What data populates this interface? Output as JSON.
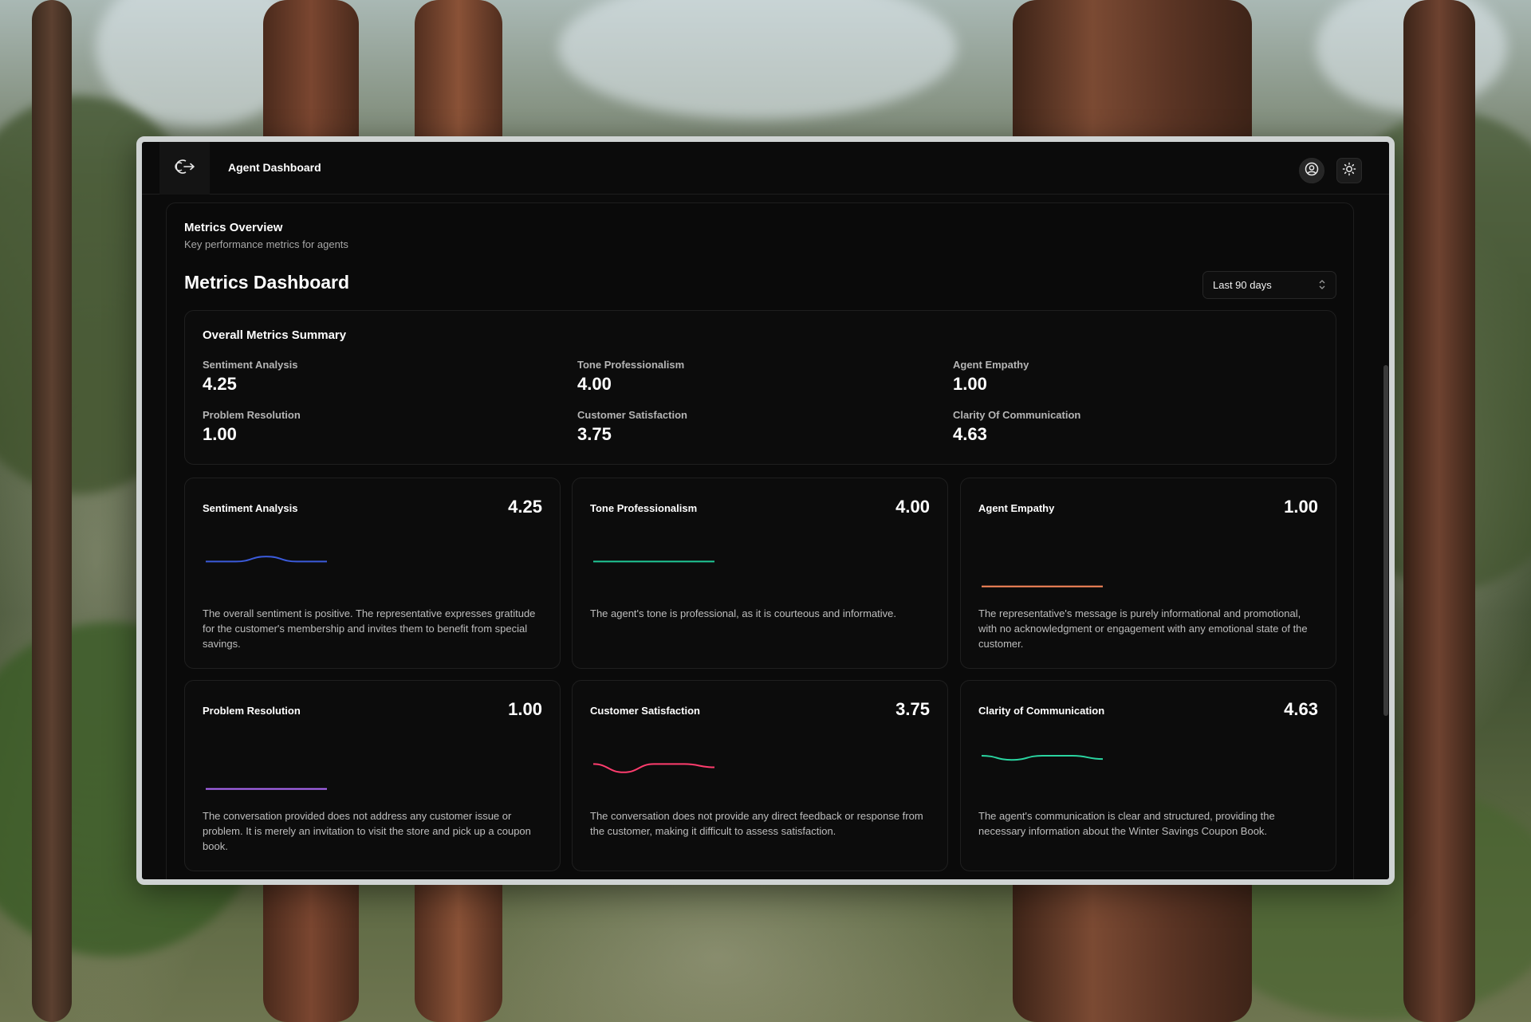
{
  "app": {
    "title": "Agent Dashboard"
  },
  "header": {
    "overview_title": "Metrics Overview",
    "overview_subtitle": "Key performance metrics for agents",
    "dashboard_title": "Metrics Dashboard",
    "range_select": "Last 90 days"
  },
  "summary": {
    "title": "Overall Metrics Summary",
    "items": [
      {
        "label": "Sentiment Analysis",
        "value": "4.25"
      },
      {
        "label": "Tone Professionalism",
        "value": "4.00"
      },
      {
        "label": "Agent Empathy",
        "value": "1.00"
      },
      {
        "label": "Problem Resolution",
        "value": "1.00"
      },
      {
        "label": "Customer Satisfaction",
        "value": "3.75"
      },
      {
        "label": "Clarity Of Communication",
        "value": "4.63"
      }
    ]
  },
  "cards": [
    {
      "title": "Sentiment Analysis",
      "score": "4.25",
      "color": "#3b5bdb",
      "trend": [
        4,
        4,
        4.6,
        4,
        4
      ],
      "description": "The overall sentiment is positive. The representative expresses gratitude for the customer's membership and invites them to benefit from special savings."
    },
    {
      "title": "Tone Professionalism",
      "score": "4.00",
      "color": "#20c997",
      "trend": [
        4,
        4,
        4,
        4,
        4
      ],
      "description": "The agent's tone is professional, as it is courteous and informative."
    },
    {
      "title": "Agent Empathy",
      "score": "1.00",
      "color": "#ff8a5c",
      "trend": [
        1,
        1,
        1,
        1,
        1
      ],
      "description": "The representative's message is purely informational and promotional, with no acknowledgment or engagement with any emotional state of the customer."
    },
    {
      "title": "Problem Resolution",
      "score": "1.00",
      "color": "#b36bff",
      "trend": [
        1,
        1,
        1,
        1,
        1
      ],
      "description": "The conversation provided does not address any customer issue or problem. It is merely an invitation to visit the store and pick up a coupon book."
    },
    {
      "title": "Customer Satisfaction",
      "score": "3.75",
      "color": "#ff3d6e",
      "trend": [
        4,
        3,
        4,
        4,
        3.6
      ],
      "description": "The conversation does not provide any direct feedback or response from the customer, making it difficult to assess satisfaction."
    },
    {
      "title": "Clarity of Communication",
      "score": "4.63",
      "color": "#2ad4a0",
      "trend": [
        5,
        4.5,
        5,
        5,
        4.6
      ],
      "description": "The agent's communication is clear and structured, providing the necessary information about the Winter Savings Coupon Book."
    }
  ]
}
